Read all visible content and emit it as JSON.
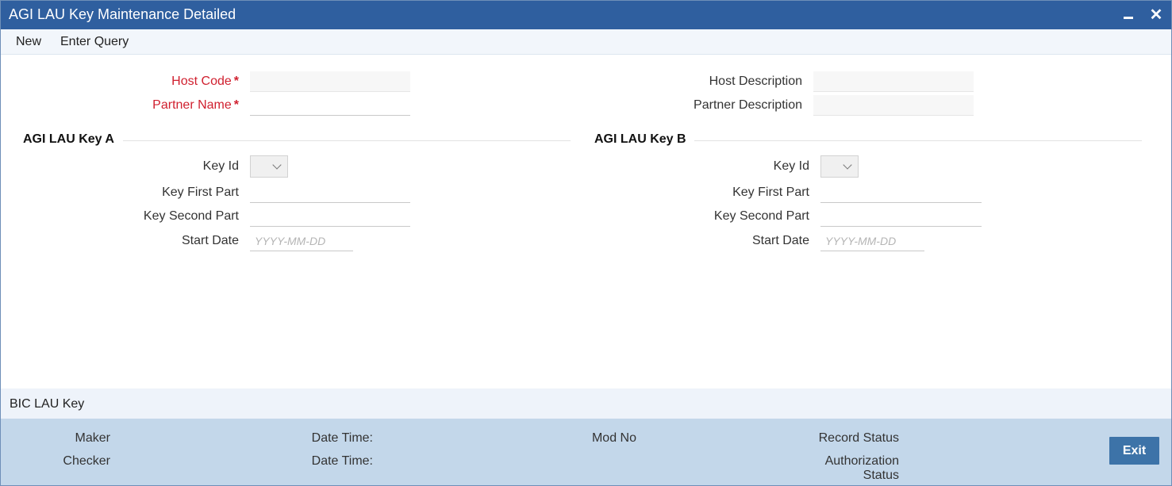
{
  "window": {
    "title": "AGI LAU Key Maintenance Detailed"
  },
  "toolbar": {
    "new_label": "New",
    "enter_query_label": "Enter Query"
  },
  "header": {
    "host_code_label": "Host Code",
    "host_code_value": "",
    "partner_name_label": "Partner Name",
    "partner_name_value": "",
    "host_description_label": "Host Description",
    "host_description_value": "",
    "partner_description_label": "Partner Description",
    "partner_description_value": "",
    "required_marker": "*"
  },
  "key_a": {
    "title": "AGI LAU Key A",
    "key_id_label": "Key Id",
    "key_id_value": "",
    "key_first_part_label": "Key First Part",
    "key_first_part_value": "",
    "key_second_part_label": "Key Second Part",
    "key_second_part_value": "",
    "start_date_label": "Start Date",
    "start_date_placeholder": "YYYY-MM-DD"
  },
  "key_b": {
    "title": "AGI LAU Key B",
    "key_id_label": "Key Id",
    "key_id_value": "",
    "key_first_part_label": "Key First Part",
    "key_first_part_value": "",
    "key_second_part_label": "Key Second Part",
    "key_second_part_value": "",
    "start_date_label": "Start Date",
    "start_date_placeholder": "YYYY-MM-DD"
  },
  "bic_bar": {
    "label": "BIC LAU Key"
  },
  "footer": {
    "maker_label": "Maker",
    "checker_label": "Checker",
    "date_time_label_1": "Date Time:",
    "date_time_label_2": "Date Time:",
    "mod_no_label": "Mod No",
    "record_status_label": "Record Status",
    "authorization_label_line1": "Authorization",
    "authorization_label_line2": "Status",
    "exit_label": "Exit"
  },
  "icons": {
    "minimize": "minimize-icon",
    "close": "close-icon",
    "dropdown": "chevron-down-icon"
  },
  "colors": {
    "title_bar": "#2f5f9f",
    "required_label": "#d0202f",
    "footer_bg": "#c3d7ea",
    "exit_button": "#3d73a8"
  }
}
